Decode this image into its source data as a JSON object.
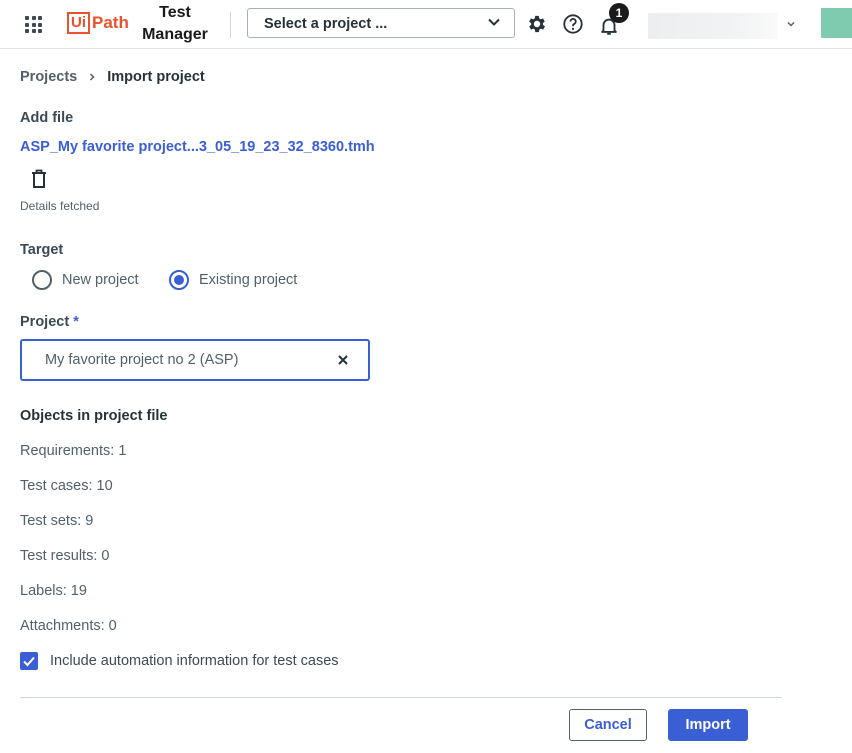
{
  "header": {
    "logo_ui": "Ui",
    "logo_path": "Path",
    "product_line1": "Test",
    "product_line2": "Manager",
    "project_select": "Select a project ...",
    "notification_count": "1"
  },
  "breadcrumb": {
    "parent": "Projects",
    "current": "Import project"
  },
  "add_file": {
    "label": "Add file",
    "file_name": "ASP_My favorite project...3_05_19_23_32_8360.tmh",
    "status": "Details fetched"
  },
  "target": {
    "label": "Target",
    "options": [
      {
        "label": "New project",
        "selected": false
      },
      {
        "label": "Existing project",
        "selected": true
      }
    ]
  },
  "project": {
    "label": "Project",
    "required_mark": "*",
    "value": "My favorite project no 2 (ASP)"
  },
  "objects": {
    "heading": "Objects in project file",
    "requirements": "Requirements: 1",
    "test_cases": "Test cases: 10",
    "test_sets": "Test sets: 9",
    "test_results": "Test results: 0",
    "labels": "Labels: 19",
    "attachments": "Attachments: 0"
  },
  "include_automation": {
    "label": "Include automation information for test cases",
    "checked": true
  },
  "actions": {
    "cancel": "Cancel",
    "import": "Import"
  },
  "colors": {
    "accent": "#3a5ed4",
    "brand": "#e8522c"
  }
}
